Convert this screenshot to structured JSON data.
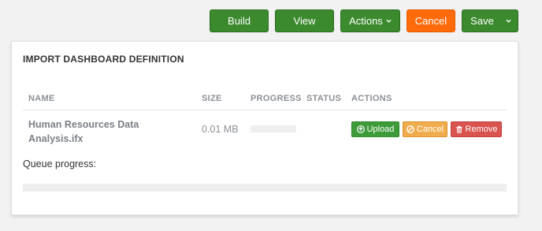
{
  "toolbar": {
    "build_label": "Build",
    "view_label": "View",
    "actions_label": "Actions",
    "cancel_label": "Cancel",
    "save_label": "Save",
    "colors": {
      "primary": "#3b8a2e",
      "cancel": "#ff6b0a"
    }
  },
  "panel": {
    "title": "IMPORT DASHBOARD DEFINITION",
    "columns": {
      "name": "NAME",
      "size": "SIZE",
      "progress": "PROGRESS",
      "status": "STATUS",
      "actions": "ACTIONS"
    },
    "file": {
      "name": "Human Resources Data Analysis.ifx",
      "size": "0.01 MB",
      "progress_fraction": 0,
      "status": "",
      "actions": {
        "upload_label": "Upload",
        "cancel_label": "Cancel",
        "remove_label": "Remove",
        "upload_icon": "circle-arrow-up-icon",
        "cancel_icon": "ban-icon",
        "remove_icon": "trash-icon",
        "colors": {
          "upload": "#3d9b3a",
          "cancel": "#f0ad4e",
          "remove": "#d9534f"
        }
      }
    },
    "queue": {
      "label": "Queue progress:",
      "progress_fraction": 0
    }
  }
}
